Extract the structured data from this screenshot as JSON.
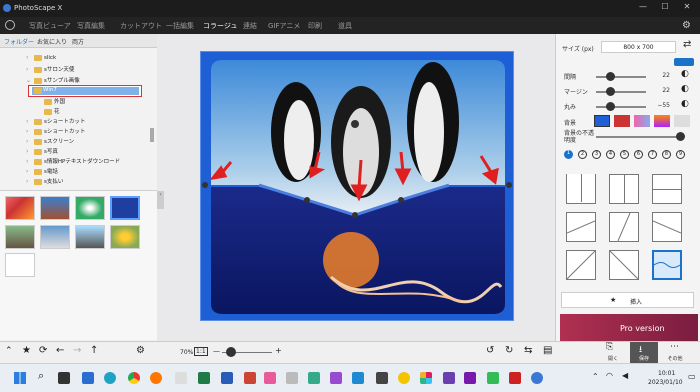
{
  "window": {
    "title": "PhotoScape X",
    "min": "—",
    "max": "☐",
    "close": "✕"
  },
  "menu": [
    {
      "label": "写真ビューア"
    },
    {
      "label": "写真編集"
    },
    {
      "label": "カットアウト"
    },
    {
      "label": "一括編集"
    },
    {
      "label": "コラージュ"
    },
    {
      "label": "連結"
    },
    {
      "label": "GIFアニメ"
    },
    {
      "label": "印刷"
    },
    {
      "label": "道具"
    }
  ],
  "left_tabs": [
    "フォルダー",
    "お気に入り",
    "両方"
  ],
  "tree": [
    {
      "label": "slick"
    },
    {
      "label": "sサロン天使"
    },
    {
      "label": "sサンプル画像"
    },
    {
      "label": "Win7"
    },
    {
      "label": "外国"
    },
    {
      "label": "花"
    },
    {
      "label": "sショートカット"
    },
    {
      "label": "sショートカット"
    },
    {
      "label": "sスクリーン"
    },
    {
      "label": "s写真"
    },
    {
      "label": "s情報HPテキストダウンロード"
    },
    {
      "label": "s電話"
    },
    {
      "label": "s支払い"
    }
  ],
  "right": {
    "size_label": "サイズ (px)",
    "size_value": "800 x 700",
    "spacing_label": "間隔",
    "spacing_value": "22",
    "margin_label": "マージン",
    "margin_value": "22",
    "round_label": "丸み",
    "round_value": "−55",
    "bg_label": "背景",
    "bg_opacity_label": "背景の不透明度",
    "insert_label": "挿入",
    "pro_text": "Pro version",
    "pages": [
      "1",
      "2",
      "3",
      "4",
      "5",
      "6",
      "7",
      "8",
      "9"
    ]
  },
  "bottom": {
    "zoom": "70%",
    "ratio": "1:1",
    "zoom_plus": "+",
    "zoom_minus": "—",
    "open_label": "開く",
    "save_label": "保存",
    "more_label": "その他"
  },
  "taskbar": {
    "time": "10:01",
    "date": "2023/01/10"
  },
  "colors": {
    "accent": "#1a73c8",
    "canvas_frame": "#1e5fd6",
    "arrow": "#e02020"
  }
}
